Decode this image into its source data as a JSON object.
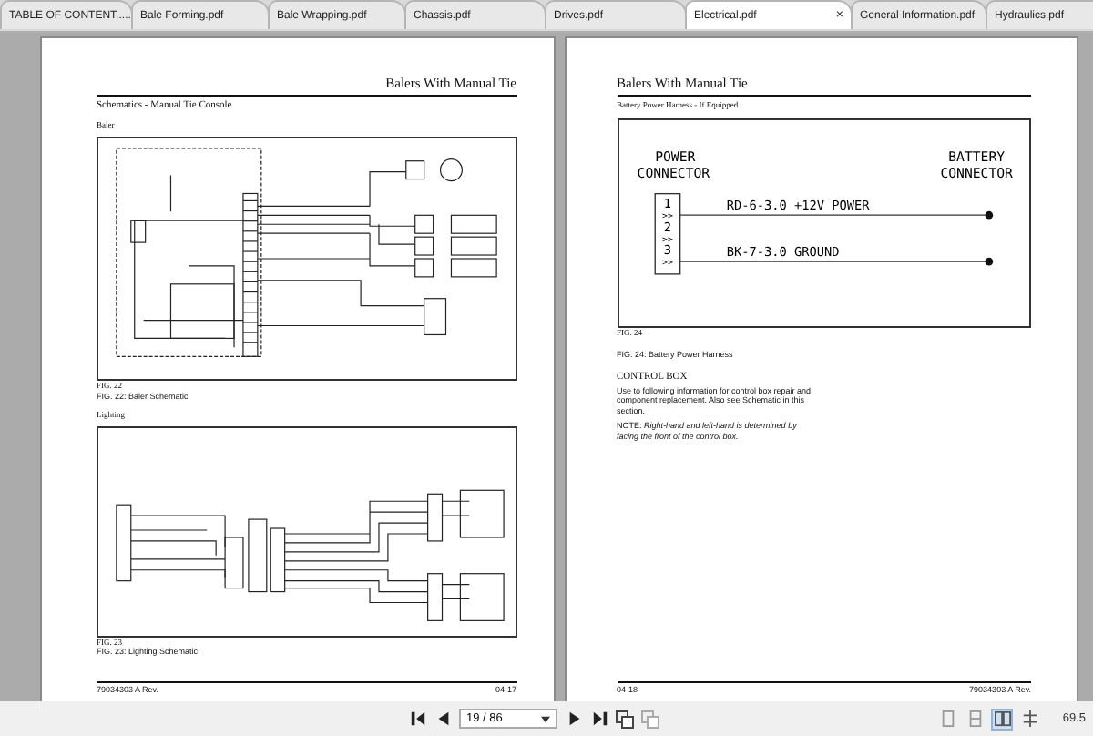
{
  "tabs": [
    {
      "label": "TABLE OF CONTENT.....",
      "selected": false
    },
    {
      "label": "Bale Forming.pdf",
      "selected": false
    },
    {
      "label": "Bale Wrapping.pdf",
      "selected": false
    },
    {
      "label": "Chassis.pdf",
      "selected": false
    },
    {
      "label": "Drives.pdf",
      "selected": false
    },
    {
      "label": "Electrical.pdf",
      "selected": true,
      "close": "×"
    },
    {
      "label": "General Information.pdf",
      "selected": false
    },
    {
      "label": "Hydraulics.pdf",
      "selected": false
    }
  ],
  "left_page": {
    "header": "Balers With Manual Tie",
    "section": "Schematics - Manual Tie Console",
    "figures": [
      {
        "kind": "baler",
        "heading": "Baler",
        "number": "FIG. 22",
        "caption": "FIG. 22: Baler Schematic"
      },
      {
        "kind": "lighting",
        "heading": "Lighting",
        "number": "FIG. 23",
        "caption": "FIG. 23: Lighting Schematic"
      }
    ],
    "footer_left": "79034303 A Rev.",
    "footer_right": "04-17"
  },
  "right_page": {
    "header": "Balers With Manual Tie",
    "section": "Battery Power Harness - If Equipped",
    "figure": {
      "source": "POWER CONNECTOR",
      "target": "BATTERY CONNECTOR",
      "pins": [
        {
          "number": "1",
          "mark": ">>"
        },
        {
          "number": "2",
          "mark": ">>"
        },
        {
          "number": "3",
          "mark": ">>"
        }
      ],
      "wires": [
        {
          "label": "RD-6-3.0 +12V POWER"
        },
        {
          "label": "BK-7-3.0 GROUND"
        }
      ],
      "number": "FIG. 24",
      "caption": "FIG. 24: Battery Power Harness"
    },
    "heading": "CONTROL BOX",
    "paragraph": "Use to following information for control box repair and component replacement. Also see Schematic in this section.",
    "note": "NOTE: *Right-hand and left-hand is determined by facing the front of the control box.*",
    "footer_left": "04-18",
    "footer_right": "79034303 A Rev."
  },
  "toolbar": {
    "page": "19 / 86",
    "zoom": "69.5",
    "view_modes": [
      {
        "selected": false
      },
      {
        "selected": false
      },
      {
        "selected": true
      },
      {
        "selected": false
      }
    ]
  }
}
